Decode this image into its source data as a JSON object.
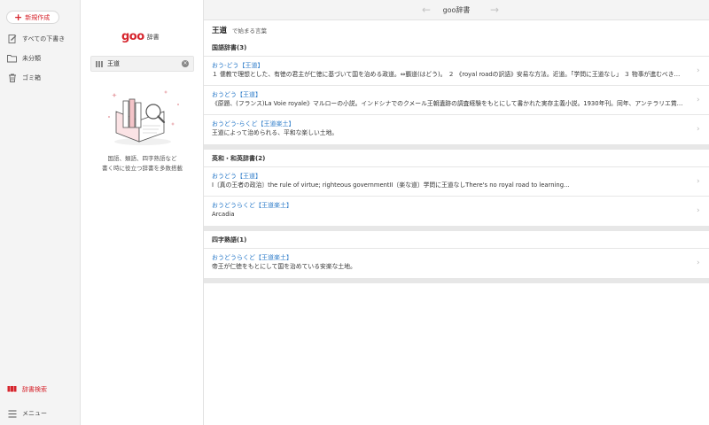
{
  "sidebar": {
    "new_label": "新規作成",
    "items": [
      {
        "label": "すべての下書き"
      },
      {
        "label": "未分類"
      },
      {
        "label": "ゴミ箱"
      }
    ],
    "bottom": [
      {
        "label": "辞書検索"
      },
      {
        "label": "メニュー"
      }
    ]
  },
  "search_panel": {
    "logo_text": "goo",
    "logo_sub": "辞書",
    "query": "王道",
    "desc_line1": "国語、類語、四字熟語など",
    "desc_line2": "書く時に役立つ辞書を多数搭載"
  },
  "main": {
    "title": "goo辞書",
    "back_arrow": "←",
    "forward_arrow": "→",
    "heading_word": "王道",
    "heading_suffix": "で始まる言葉",
    "chevron": "›",
    "sections": [
      {
        "title": "国語辞書(3)",
        "entries": [
          {
            "reading": "おう‐どう【王道】",
            "def": "１ 儒教で理想とした、有徳の君主が仁徳に基づいて国を治める政道。⇔覇道(はどう)。 ２ 《royal roadの訳語》安易な方法。近道。「学問に王道なし」 ３ 物事が進むべき…"
          },
          {
            "reading": "おうどう【王道】",
            "def": "《原題、(フランス)La Voie royale》マルローの小説。インドシナでのクメール王朝遺跡の調査経験をもとにして書かれた実存主義小説。1930年刊。同年、アンテラリエ賞…"
          },
          {
            "reading": "おうどう‐らくど【王道楽土】",
            "def": "王道によって治められる、平和な楽しい土地。"
          }
        ]
      },
      {
        "title": "英和・和英辞書(2)",
        "entries": [
          {
            "reading": "おうどう【王道】",
            "def": "I〔真の王者の政治〕the rule of virtue; righteous governmentII〔楽な道〕学問に王道なしThere's no royal road to learning..."
          },
          {
            "reading": "おうどうらくど【王道楽土】",
            "def": "Arcadia"
          }
        ]
      },
      {
        "title": "四字熟語(1)",
        "entries": [
          {
            "reading": "おうどうらくど【王道楽土】",
            "def": "帝王が仁徳をもとにして国を治めている安楽な土地。"
          }
        ]
      }
    ]
  }
}
